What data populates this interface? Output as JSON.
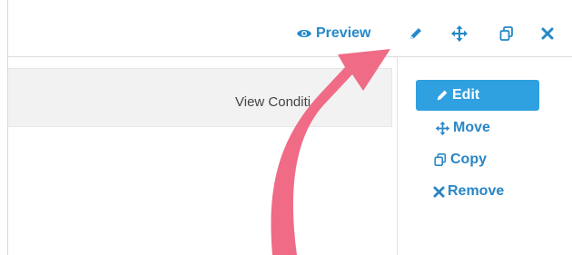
{
  "toolbar": {
    "preview_label": "Preview",
    "icons": [
      "eye-icon",
      "pencil-icon",
      "move-icon",
      "copy-icon",
      "close-icon"
    ]
  },
  "panel": {
    "title": "View Conditi"
  },
  "menu": {
    "items": [
      {
        "label": "Edit",
        "icon": "pencil-icon"
      },
      {
        "label": "Move",
        "icon": "move-icon"
      },
      {
        "label": "Copy",
        "icon": "copy-icon"
      },
      {
        "label": "Remove",
        "icon": "close-icon"
      }
    ]
  },
  "colors": {
    "link": "#2589c9",
    "active_bg": "#2fa0e0",
    "panel_bg": "#f2f2f2",
    "annotation_arrow": "#f06b86"
  }
}
